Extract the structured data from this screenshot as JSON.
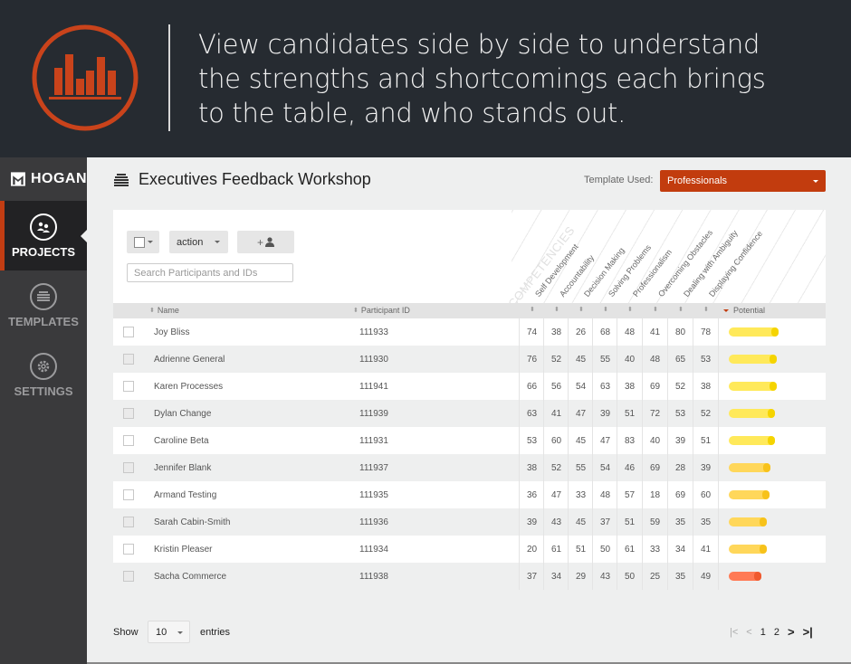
{
  "banner": {
    "lines": [
      "View candidates side by side to understand",
      "the strengths and shortcomings each brings",
      "to the table, and who stands out."
    ],
    "accent_color": "#c9431b"
  },
  "sidebar": {
    "brand": "HOGAN",
    "items": [
      {
        "label": "PROJECTS",
        "icon": "people-icon",
        "active": true
      },
      {
        "label": "TEMPLATES",
        "icon": "stack-icon",
        "active": false
      },
      {
        "label": "SETTINGS",
        "icon": "gear-icon",
        "active": false
      }
    ]
  },
  "header": {
    "title": "Executives Feedback Workshop",
    "template_label": "Template Used:",
    "template_value": "Professionals"
  },
  "toolbar": {
    "action_label": "action",
    "add_label": "+",
    "search_placeholder": "Search Participants and IDs"
  },
  "table": {
    "competencies_title": "COMPETENCIES",
    "competencies": [
      "Self Development",
      "Accountability",
      "Decision Making",
      "Solving Problems",
      "Professionalism",
      "Overcoming Obstacles",
      "Dealing with Ambiguity",
      "Displaying Confidence"
    ],
    "columns": {
      "name": "Name",
      "pid": "Participant ID",
      "potential": "Potential"
    },
    "rows": [
      {
        "name": "Joy Bliss",
        "pid": "111933",
        "scores": [
          "74",
          "38",
          "26",
          "68",
          "48",
          "41",
          "80",
          "78"
        ],
        "potential": 0.88,
        "color": "#ffe95a",
        "end": "#f5d400"
      },
      {
        "name": "Adrienne General",
        "pid": "111930",
        "scores": [
          "76",
          "52",
          "45",
          "55",
          "40",
          "48",
          "65",
          "53"
        ],
        "potential": 0.86,
        "color": "#ffe95a",
        "end": "#f5d400"
      },
      {
        "name": "Karen Processes",
        "pid": "111941",
        "scores": [
          "66",
          "56",
          "54",
          "63",
          "38",
          "69",
          "52",
          "38"
        ],
        "potential": 0.86,
        "color": "#ffe95a",
        "end": "#f5d400"
      },
      {
        "name": "Dylan Change",
        "pid": "111939",
        "scores": [
          "63",
          "41",
          "47",
          "39",
          "51",
          "72",
          "53",
          "52"
        ],
        "potential": 0.82,
        "color": "#ffe95a",
        "end": "#f5d400"
      },
      {
        "name": "Caroline Beta",
        "pid": "111931",
        "scores": [
          "53",
          "60",
          "45",
          "47",
          "83",
          "40",
          "39",
          "51"
        ],
        "potential": 0.82,
        "color": "#ffe95a",
        "end": "#f5d400"
      },
      {
        "name": "Jennifer Blank",
        "pid": "111937",
        "scores": [
          "38",
          "52",
          "55",
          "54",
          "46",
          "69",
          "28",
          "39"
        ],
        "potential": 0.74,
        "color": "#ffd75a",
        "end": "#f7c21a"
      },
      {
        "name": "Armand Testing",
        "pid": "111935",
        "scores": [
          "36",
          "47",
          "33",
          "48",
          "57",
          "18",
          "69",
          "60"
        ],
        "potential": 0.72,
        "color": "#ffd75a",
        "end": "#f7c21a"
      },
      {
        "name": "Sarah Cabin-Smith",
        "pid": "111936",
        "scores": [
          "39",
          "43",
          "45",
          "37",
          "51",
          "59",
          "35",
          "35"
        ],
        "potential": 0.68,
        "color": "#ffd75a",
        "end": "#f7c21a"
      },
      {
        "name": "Kristin Pleaser",
        "pid": "111934",
        "scores": [
          "20",
          "61",
          "51",
          "50",
          "61",
          "33",
          "34",
          "41"
        ],
        "potential": 0.68,
        "color": "#ffd75a",
        "end": "#f7c21a"
      },
      {
        "name": "Sacha Commerce",
        "pid": "111938",
        "scores": [
          "37",
          "34",
          "29",
          "43",
          "50",
          "25",
          "35",
          "49"
        ],
        "potential": 0.58,
        "color": "#ff7a55",
        "end": "#f05a2f"
      }
    ]
  },
  "footer": {
    "show_label": "Show",
    "page_size": "10",
    "entries_label": "entries",
    "pages": [
      "1",
      "2"
    ],
    "first": "|<",
    "prev": "<",
    "next": ">",
    "last": ">|"
  }
}
